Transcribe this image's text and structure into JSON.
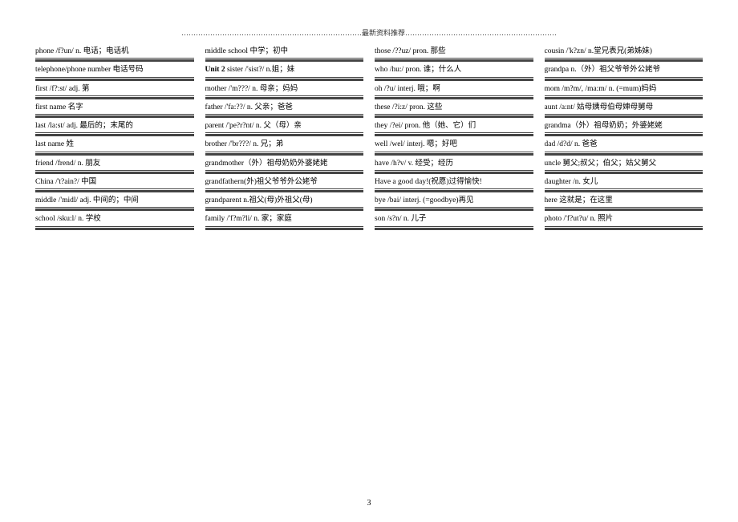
{
  "header": "…………………………………………………………………最新资料推荐………………………………………………………",
  "pageNumber": "3",
  "columns": [
    [
      "phone /f?un/ n.  电话；电话机",
      "telephone/phone number  电话号码",
      "first /f?:st/ adj.  第",
      "first name  名字",
      "last /la:st/ adj.  最后的；末尾的",
      "last name  姓",
      "friend /frend/ n.  朋友",
      "China  /'t?ain?/  中国",
      "middle /'midl/ adj.  中间的；中间",
      "school /sku:l/ n.  学校"
    ],
    [
      "middle school  中学；初中",
      {
        "bold": "Unit 2",
        "text": " sister /'sist?/ n.姐；妹"
      },
      "mother /'m???/ n.  母亲；妈妈",
      "father /'fa:??/ n.  父亲；爸爸",
      "parent /'pe?r?nt/ n.  父（母）亲",
      "brother /'br???/ n.  兄；弟",
      "grandmother（外）祖母奶奶外婆姥姥",
      "grandfathern(外)祖父爷爷外公姥爷",
      "grandparent n.祖父(母)外祖父(母)",
      "family  /'f?m?li/ n.  家；家庭"
    ],
    [
      "those /??uz/ pron.  那些",
      "who /hu:/ pron.  谁；什么人",
      "oh /?u/ interj.  哦；啊",
      "these /?i:z/ pron.  这些",
      "they /?ei/ pron.  他（她、它）们",
      "well /wel/ interj.  嗯；好吧",
      "have /h?v/ v.  经受；经历",
      "Have a good day!(祝愿)过得愉快!",
      "bye /bai/ interj. (=goodbye)再见",
      "son /s?n/ n.  儿子"
    ],
    [
      "cousin /'k?zn/ n.堂兄表兄(弟姊妹)",
      "grandpa  n.（外）祖父爷爷外公姥爷",
      "mom /m?m/, /ma:m/ n. (=mum)妈妈",
      "aunt /a:nt/  姑母姨母伯母婶母舅母",
      "grandma（外）祖母奶奶；外婆姥姥",
      "dad /d?d/ n.  爸爸",
      "uncle 舅父;叔父；伯父；姑父舅父",
      "daughter /n.  女儿",
      "here    这就是；在这里",
      "photo /'f?ut?u/ n.  照片"
    ]
  ]
}
